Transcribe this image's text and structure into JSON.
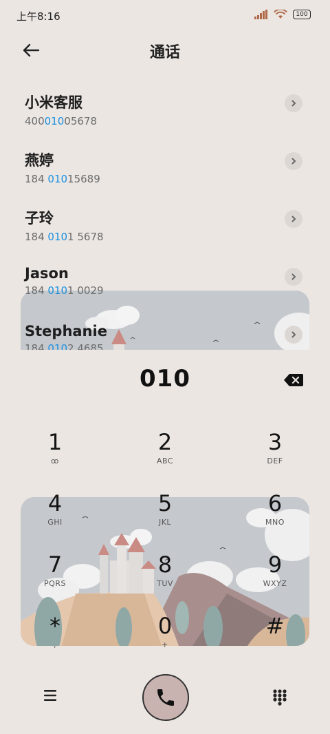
{
  "status": {
    "time": "上午8:16",
    "battery": "100"
  },
  "header": {
    "title": "通话"
  },
  "contacts": [
    {
      "name": "小米客服",
      "num_pre": "400",
      "num_hl": "010",
      "num_post": "05678"
    },
    {
      "name": "燕婷",
      "num_pre": "184 ",
      "num_hl": "010",
      "num_post": "15689"
    },
    {
      "name": "子玲",
      "num_pre": "184 ",
      "num_hl": "010",
      "num_post": "1 5678"
    },
    {
      "name": "Jason",
      "num_pre": "184 ",
      "num_hl": "010",
      "num_post": "1 0029"
    },
    {
      "name": "Stephanie",
      "num_pre": "184 ",
      "num_hl": "010",
      "num_post": "2 4685"
    }
  ],
  "dial": {
    "digits": "010"
  },
  "keys": [
    {
      "d": "1",
      "l": "ꝏ"
    },
    {
      "d": "2",
      "l": "ABC"
    },
    {
      "d": "3",
      "l": "DEF"
    },
    {
      "d": "4",
      "l": "GHI"
    },
    {
      "d": "5",
      "l": "JKL"
    },
    {
      "d": "6",
      "l": "MNO"
    },
    {
      "d": "7",
      "l": "PQRS"
    },
    {
      "d": "8",
      "l": "TUV"
    },
    {
      "d": "9",
      "l": "WXYZ"
    },
    {
      "d": "*",
      "l": ","
    },
    {
      "d": "0",
      "l": "+"
    },
    {
      "d": "#",
      "l": ""
    }
  ],
  "icons": {
    "back": "back-arrow-icon",
    "delete": "backspace-icon",
    "menu": "hamburger-menu-icon",
    "call": "phone-icon",
    "keypad": "keypad-grid-icon"
  },
  "colors": {
    "background": "#ebe6e2",
    "highlight": "#1a8fe0",
    "call_button": "#c9b3b1"
  }
}
